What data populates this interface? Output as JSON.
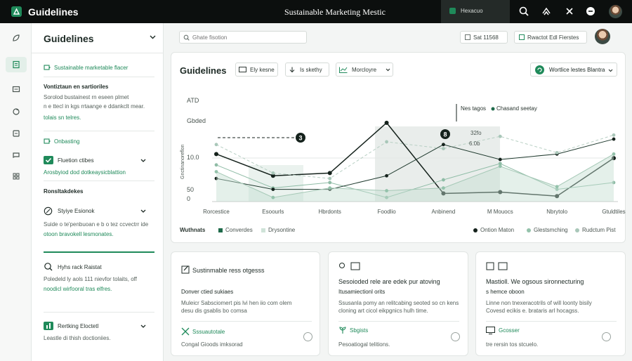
{
  "topbar": {
    "app_title": "Guidelines",
    "center_title": "Sustainable Marketing Mestic",
    "workspace_label": "Hexacuo",
    "icons": [
      "search-icon",
      "recycle-icon",
      "bell-icon",
      "minus-circle-icon"
    ]
  },
  "rail": {
    "icons": [
      "leaf-icon",
      "document-icon",
      "mail-icon",
      "recycle-icon",
      "box-icon",
      "chat-icon",
      "grid-icon"
    ],
    "active_index": 1
  },
  "sidebar": {
    "title": "Guidelines",
    "item1_label": "Sustainable marketable flacer",
    "section1_title": "Vontiztaun en sartioriles",
    "section1_line1": "Sorolod bustainest rn eseen plmet",
    "section1_line2": "n e ttecl in kgs rrtaange e ddankclt mear.",
    "section1_link": "tolais sn telres.",
    "item2_label": "Onbasting",
    "item3_label": "Fluetion ctibes",
    "item3_sub": "Arosbyiod dod dotkeaysicblattion",
    "section2_title": "Ronsltakdekes",
    "item4_label": "Styiye Esionok",
    "item4_line1": "Suide o te'penbuoan e b o tez ccvectrr ide",
    "item4_line2": "otoon bravokell lesmonates.",
    "item5_label": "Hyhs rack Raistat",
    "item5_line1": "Poledeld ly aols 111 nievfor tolaits, off",
    "item5_line2": "noodicl wirfooral tras elfres.",
    "item6_label": "Rertking Eloctetl",
    "item6_sub": "Leastle di thish doctioniies."
  },
  "search": {
    "placeholder": "Ghate fisotion"
  },
  "filters": {
    "pill1": "Sat 11568",
    "pill2": "Rwactot Edl Fierstes"
  },
  "panel": {
    "title": "Guidelines",
    "btn1": "Ely kesne",
    "btn2": "Is skethy",
    "btn3": "Morcloyre",
    "filter_label": "Wortlice lestes Blantra"
  },
  "chart_data": {
    "type": "line",
    "y_labels": [
      "ATD",
      "Gbded",
      "10.0",
      "50",
      "0"
    ],
    "ylabel": "Gnctinanoreflon",
    "categories": [
      "Rorcestice",
      "Esoourls",
      "Hbrdonts",
      "Foodlio",
      "Anbinend",
      "M Mouocs",
      "Nbrytolo",
      "Gtuldtiles"
    ],
    "series": [
      {
        "name": "Converdes",
        "values": [
          70,
          38,
          42,
          116,
          12,
          14,
          8,
          64
        ]
      },
      {
        "name": "Drysontine",
        "values": [
          54,
          20,
          28,
          6,
          32,
          56,
          18,
          28
        ]
      },
      {
        "name": "Ontion Maton",
        "values": [
          34,
          18,
          18,
          38,
          84,
          62,
          70,
          92
        ]
      },
      {
        "name": "Glestsmching",
        "values": [
          44,
          6,
          20,
          16,
          20,
          52,
          22,
          70
        ]
      },
      {
        "name": "Rudctum Pist",
        "values": [
          84,
          42,
          34,
          88,
          78,
          96,
          72,
          98
        ]
      }
    ],
    "annotations": {
      "marker_a": "3",
      "marker_b": "8",
      "tag_label": "Nes tagos",
      "tag2_label": "Chasand seetay",
      "value_1": "32fo",
      "value_2": "6.0b"
    },
    "legend_label": "Wuthnats"
  },
  "cards": [
    {
      "title": "Sustinmable ress otgesss",
      "sub": "Donver ctied sukiaes",
      "line1": "Muleicr Sabsciomert pis lvi hen iio com olem",
      "line2": "desu dis gsablis bo comsa",
      "foot1": "Sssuautotale",
      "foot2": "Congal Gioods imksorad"
    },
    {
      "title": "Sesoioded rele are edek pur atoving",
      "sub": "Itusamiectionl orits",
      "line1": "Ssusanla pomy an relitcabing seoted so cn kens",
      "line2": "cloning art cicol eikpgnics hulh time.",
      "foot1": "Sbgists",
      "foot2": "Pesoatiogal telitions."
    },
    {
      "title": "Mastioll. We ogsous sironnecturing",
      "sub": "s hemce oboon",
      "line1": "Linne non tnexeracotrils of will loonty bisily",
      "line2": "Covesd ecikis e. brataris arl hocagss.",
      "foot1": "Gcosser",
      "foot2": "tre rersin tos stcuelo."
    }
  ]
}
